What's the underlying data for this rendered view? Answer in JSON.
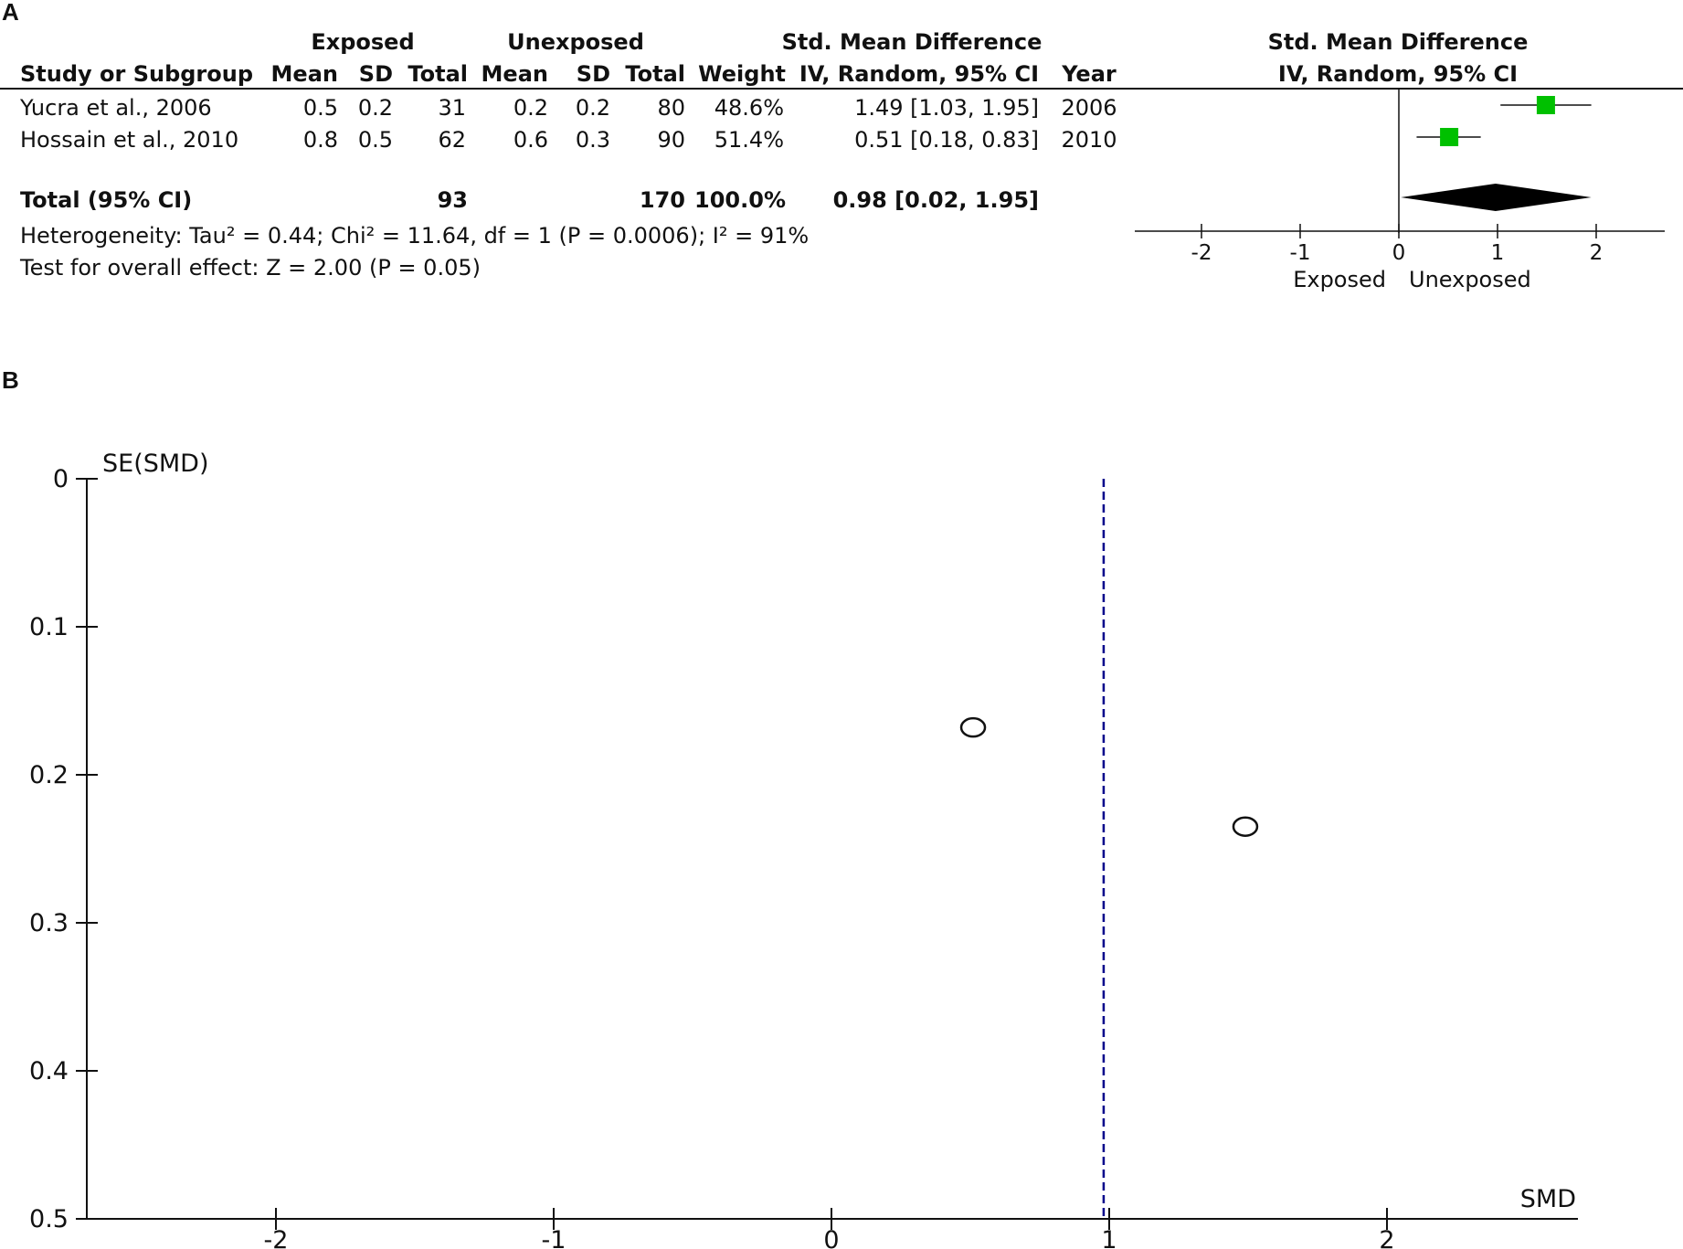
{
  "panels": [
    "A",
    "B"
  ],
  "colors": {
    "square": "#00c000",
    "diamond": "#000000",
    "dashed_line": "#00008b",
    "ink": "#111111"
  },
  "forest": {
    "group_exposed": "Exposed",
    "group_unexposed": "Unexposed",
    "col_smd_top": "Std. Mean Difference",
    "col_smd_sub": "IV, Random, 95% CI",
    "plot_title": "Std. Mean Difference",
    "plot_subtitle": "IV, Random, 95% CI",
    "headers": {
      "study": "Study or Subgroup",
      "mean": "Mean",
      "sd": "SD",
      "total": "Total",
      "weight": "Weight",
      "year": "Year"
    },
    "rows": [
      {
        "study": "Yucra et al., 2006",
        "e_mean": "0.5",
        "e_sd": "0.2",
        "e_total": "31",
        "u_mean": "0.2",
        "u_sd": "0.2",
        "u_total": "80",
        "weight": "48.6%",
        "ci": "1.49 [1.03, 1.95]",
        "year": "2006"
      },
      {
        "study": "Hossain et al., 2010",
        "e_mean": "0.8",
        "e_sd": "0.5",
        "e_total": "62",
        "u_mean": "0.6",
        "u_sd": "0.3",
        "u_total": "90",
        "weight": "51.4%",
        "ci": "0.51 [0.18, 0.83]",
        "year": "2010"
      }
    ],
    "total": {
      "label": "Total (95% CI)",
      "e_total": "93",
      "u_total": "170",
      "weight": "100.0%",
      "ci": "0.98 [0.02, 1.95]"
    },
    "heterogeneity": "Heterogeneity: Tau² = 0.44; Chi² = 11.64, df = 1 (P = 0.0006); I² = 91%",
    "overall_effect": "Test for overall effect: Z = 2.00 (P = 0.05)",
    "favours_left": "Exposed",
    "favours_right": "Unexposed"
  },
  "chart_data": [
    {
      "type": "scatter",
      "title": "",
      "subtitle": "",
      "xlabel": "",
      "ylabel": "",
      "xlim": [
        -2,
        2
      ],
      "x_ticks": [
        "-2",
        "-1",
        "0",
        "1",
        "2"
      ],
      "null_line": 0,
      "studies": [
        {
          "name": "Yucra et al., 2006",
          "smd": 1.49,
          "ci_low": 1.03,
          "ci_high": 1.95,
          "weight": 48.6
        },
        {
          "name": "Hossain et al., 2010",
          "smd": 0.51,
          "ci_low": 0.18,
          "ci_high": 0.83,
          "weight": 51.4
        }
      ],
      "pooled": {
        "smd": 0.98,
        "ci_low": 0.02,
        "ci_high": 1.95
      }
    },
    {
      "type": "scatter",
      "title": "",
      "xlabel": "SMD",
      "ylabel": "SE(SMD)",
      "xlim": [
        -2.7,
        2.7
      ],
      "ylim": [
        0,
        0.5
      ],
      "y_reversed": true,
      "x_ticks": [
        "-2",
        "-1",
        "0",
        "1",
        "2"
      ],
      "y_ticks": [
        "0",
        "0.1",
        "0.2",
        "0.3",
        "0.4",
        "0.5"
      ],
      "pooled_line_x": 0.98,
      "points": [
        {
          "x": 0.51,
          "y": 0.168
        },
        {
          "x": 1.49,
          "y": 0.235
        }
      ]
    }
  ]
}
